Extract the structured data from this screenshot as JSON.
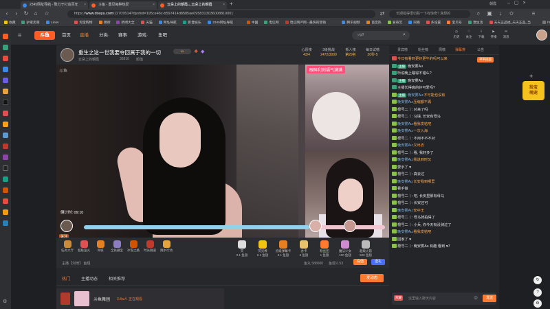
{
  "browser": {
    "tabs": [
      {
        "label": "2345网址导航 - 致力于打造百年",
        "fav": "#3c8ae6"
      },
      {
        "label": "斗鱼 - 重见每种热爱",
        "fav": "#ff5d23"
      },
      {
        "label": "云朵上的朝霞ᴗ_云朵上的朝霞",
        "fav": "#ff5d23",
        "active": true
      }
    ],
    "window_title": "朝霞",
    "url_prefix": "https://",
    "url_host": "www.douyu.com",
    "url_rest": "/12709514?dyshid=195ce46c-b597414d8585ae0958313036008810001",
    "search_box": "长期错得很切跌一下有惊奇? 真想的",
    "bookmarks": [
      "收藏",
      "驴家卖萌",
      "Links",
      "淘宝购物",
      "稿牌",
      "新闻大全",
      "天猫",
      "网址导航",
      "影音娱乐",
      "2345网址导航",
      "中国",
      "电信网",
      "电信网严网 - 最快的营销",
      "腾讯视频",
      "百度热",
      "爱奇艺",
      "同看",
      "多设置",
      "宝贝号",
      "激生活",
      "天天正品福_天天正品_当",
      "https://www.okl89"
    ]
  },
  "douyu_header": {
    "logo": "斗鱼",
    "nav": [
      "首页",
      "直播",
      "分类·",
      "赛事",
      "游戏·",
      "鱼吧"
    ],
    "search_placeholder": "yigff",
    "icons": [
      "历史",
      "关注",
      "下载",
      "开播",
      "消息"
    ]
  },
  "room": {
    "title": "重生之这一世我要夺回属于我的一切",
    "sub": "云朵上的朝霞",
    "room_no": "35816",
    "category": "颜值",
    "stats": [
      {
        "label": "心愿榜",
        "value": "43/4"
      },
      {
        "label": "3级挑战",
        "value": "2472/3000"
      },
      {
        "label": "新人榜",
        "value": "第29名"
      },
      {
        "label": "每日试榜",
        "value": "20秒◦5"
      }
    ]
  },
  "video": {
    "pip_label": "眼眸利刺福气满满",
    "timer": "倒计时: 09:10",
    "league_label": "关注"
  },
  "toolbar": {
    "left": [
      "任务大厅",
      "超级萤火",
      "商城",
      "全民藏宝",
      "冰雪之路",
      "时光隧道",
      "跳水行动"
    ],
    "right": [
      {
        "name": "荧",
        "price": "0.1 鱼翅"
      },
      {
        "name": "荧光棒",
        "price": "0.1 鱼翅"
      },
      {
        "name": "初级弹幕卡",
        "price": "0.1 鱼翅"
      },
      {
        "name": "办卡",
        "price": "6 鱼翅"
      },
      {
        "name": "粉丝团",
        "price": "1 鱼翅"
      },
      {
        "name": "魔法少女",
        "price": "100 鱼翅"
      },
      {
        "name": "超级火箭",
        "price": "500 鱼翅"
      }
    ],
    "bottom_left": "主播【刘琦】 鱼翅",
    "fishball": "鱼丸 588600",
    "fishfin": "鱼翅 0.53",
    "recharge_btn": "充值",
    "fins_btn": "送礼"
  },
  "lower_tabs": {
    "items": [
      "热门",
      "主播动态",
      "相关推荐"
    ],
    "action_btn": "发动态",
    "rank_label": "斗鱼舞团",
    "rank_sub": "3.8w人 正在观看"
  },
  "chat": {
    "tabs": [
      "贵宾榜",
      "粉丝榜",
      "周榜",
      "弹幕排",
      "公告"
    ],
    "tab_active": 3,
    "top_badge": "平平民级",
    "messages": [
      {
        "lv": "#e05050",
        "name": "",
        "txt": "今日有看到更好更牛的吗可以来",
        "o": true
      },
      {
        "lv": "#3aa07a",
        "badge": "主播",
        "name": "",
        "txt": "晚安雾Au"
      },
      {
        "lv": "#3aa07a",
        "badge": "",
        "name": "",
        "txt": "听说晚上睡得不错么?"
      },
      {
        "lv": "#3aa07a",
        "badge": "主播",
        "name": "",
        "txt": "晚安雾Au"
      },
      {
        "lv": "#3aa07a",
        "badge": "",
        "name": "",
        "txt": "主播长得真的好可爱吗?"
      },
      {
        "lv": "#8bc34a",
        "badge": "主播",
        "name": "晚安雾Au:",
        "txt": "不可能也没有",
        "o": true
      },
      {
        "lv": "#8bc34a",
        "badge": "",
        "name": "晚安雾Au:",
        "txt": "压缩都不再",
        "o": true
      },
      {
        "lv": "#8bc34a",
        "badge": "",
        "name": "",
        "txt": "根号二丨: 对来了吗"
      },
      {
        "lv": "#8bc34a",
        "badge": "",
        "name": "",
        "txt": "根号二丨: 马境, 长安有母马"
      },
      {
        "lv": "#8bc34a",
        "badge": "",
        "name": "晚安雾Au:",
        "txt": "看我发帖吧",
        "o": true
      },
      {
        "lv": "#8bc34a",
        "badge": "",
        "name": "晚安雾Au:",
        "txt": "一次入海",
        "o": true
      },
      {
        "lv": "#8bc34a",
        "badge": "",
        "name": "",
        "txt": "根号二丨: 不用不不不对"
      },
      {
        "lv": "#8bc34a",
        "badge": "",
        "name": "晚安雾Au:",
        "txt": "又出去",
        "o": true
      },
      {
        "lv": "#8bc34a",
        "badge": "",
        "name": "",
        "txt": "根号二丨: 看, 我好多了"
      },
      {
        "lv": "#8bc34a",
        "badge": "",
        "name": "晚安雾Au:",
        "txt": "我说到时又",
        "o": true
      },
      {
        "lv": "#8bc34a",
        "badge": "",
        "name": "",
        "txt": "要手了 ♥"
      },
      {
        "lv": "#8bc34a",
        "badge": "",
        "name": "",
        "txt": "根号二丨: 真去过"
      },
      {
        "lv": "#8bc34a",
        "badge": "",
        "name": "晚安雾Au:",
        "txt": "长安我到哪里",
        "o": true
      },
      {
        "lv": "#8bc34a",
        "badge": "",
        "name": "",
        "txt": "看手做"
      },
      {
        "lv": "#8bc34a",
        "badge": "",
        "name": "",
        "txt": "根号二丨: 吧, 长安里那有母马"
      },
      {
        "lv": "#8bc34a",
        "badge": "",
        "name": "",
        "txt": "根号二丨: 长安还可"
      },
      {
        "lv": "#8bc34a",
        "badge": "",
        "name": "晚安雾Au:",
        "txt": "安中王",
        "o": true
      },
      {
        "lv": "#8bc34a",
        "badge": "",
        "name": "",
        "txt": "根号二丨: 母马骑拍得了"
      },
      {
        "lv": "#8bc34a",
        "badge": "",
        "name": "",
        "txt": "根号二丨: 小兵, 你今天有没骑过了"
      },
      {
        "lv": "#8bc34a",
        "badge": "",
        "name": "晚安雾Au:",
        "txt": "看我发帖吧",
        "o": true
      },
      {
        "lv": "#8bc34a",
        "badge": "",
        "name": "",
        "txt": "回家了 ♥"
      },
      {
        "lv": "#8bc34a",
        "badge": "",
        "name": "",
        "txt": "根号二丨: 晚安雾Au 有趣 看到 ♥7"
      }
    ],
    "input_placeholder": "这里输入聊天内容",
    "send_btn": "发送",
    "badge_level": "荣耀"
  },
  "promo": {
    "label": "捡宝\n萌宠"
  }
}
